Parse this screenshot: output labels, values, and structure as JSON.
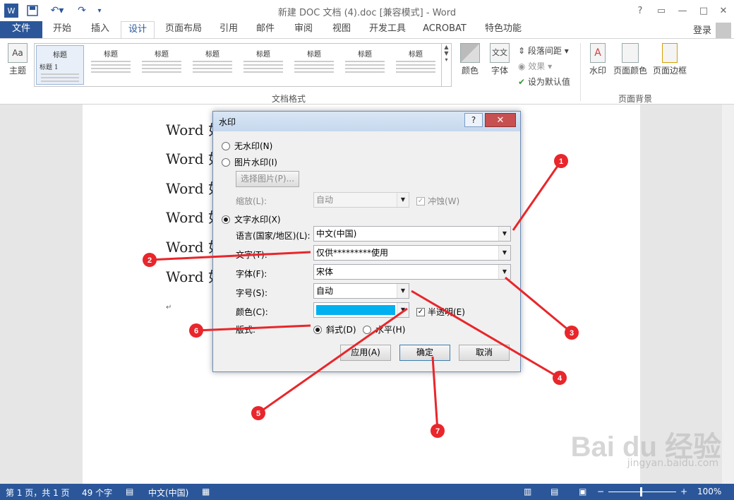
{
  "window": {
    "title": "新建 DOC 文档 (4).doc [兼容模式] - Word",
    "app_icon": "W",
    "help": "?",
    "minimize": "—",
    "restore": "□",
    "close": "✕"
  },
  "tabs": [
    "文件",
    "开始",
    "插入",
    "设计",
    "页面布局",
    "引用",
    "邮件",
    "审阅",
    "视图",
    "开发工具",
    "ACROBAT",
    "特色功能"
  ],
  "account": {
    "login": "登录"
  },
  "ribbon": {
    "theme": "主题",
    "gallery_thumbs": [
      "标题",
      "标题",
      "标题",
      "标题",
      "标题",
      "标题",
      "标题",
      "标题"
    ],
    "gallery_sub": "标题 1",
    "colors": "颜色",
    "fonts": "字体",
    "para_spacing": "段落间距",
    "effects": "效果",
    "set_default": "设为默认值",
    "watermark": "水印",
    "page_color": "页面颜色",
    "page_border": "页面边框",
    "group_doc_format": "文档格式",
    "group_page_bg": "页面背景"
  },
  "document": {
    "lines": [
      "Word 如何添加水印",
      "Word 如",
      "Word 如",
      "Word 如",
      "Word 如",
      "Word 如"
    ],
    "para_mark": "↵"
  },
  "dialog": {
    "title": "水印",
    "help": "?",
    "close": "✕",
    "no_watermark": "无水印(N)",
    "picture_watermark": "图片水印(I)",
    "select_picture": "选择图片(P)...",
    "scale_label": "缩放(L):",
    "scale_value": "自动",
    "washout": "冲蚀(W)",
    "text_watermark": "文字水印(X)",
    "language_label": "语言(国家/地区)(L):",
    "language_value": "中文(中国)",
    "text_label": "文字(T):",
    "text_value": "仅供*********使用",
    "font_label": "字体(F):",
    "font_value": "宋体",
    "size_label": "字号(S):",
    "size_value": "自动",
    "color_label": "颜色(C):",
    "color_value": "#00b0f0",
    "semi_transparent": "半透明(E)",
    "layout_label": "版式:",
    "diagonal": "斜式(D)",
    "horizontal": "水平(H)",
    "apply": "应用(A)",
    "ok": "确定",
    "cancel": "取消"
  },
  "status": {
    "page": "第 1 页，共 1 页",
    "words": "49 个字",
    "language": "中文(中国)",
    "zoom": "100%",
    "minus": "−",
    "plus": "+"
  },
  "annotations": [
    "1",
    "2",
    "3",
    "4",
    "5",
    "6",
    "7"
  ],
  "baidu": {
    "logo": "Bai du 经验",
    "url": "jingyan.baidu.com"
  },
  "colors": {
    "accent": "#2b579a",
    "annotation": "#e8262b",
    "watermark_color": "#00b0f0"
  }
}
